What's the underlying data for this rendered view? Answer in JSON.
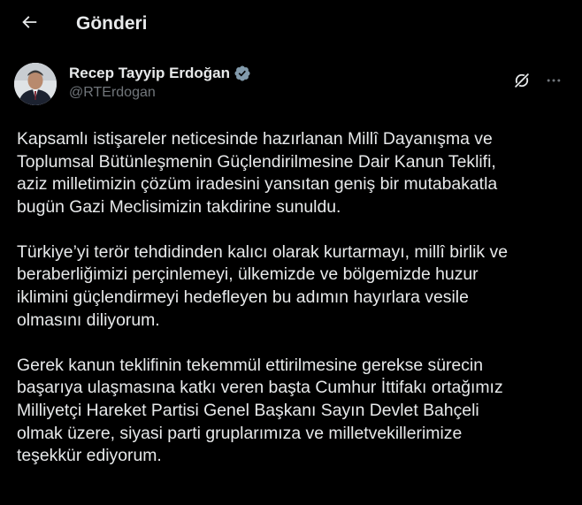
{
  "header": {
    "title": "Gönderi",
    "back_icon": "arrow-left-icon"
  },
  "author": {
    "display_name": "Recep Tayyip Erdoğan",
    "handle": "@RTErdogan",
    "verified_icon": "verified-badge-icon",
    "verified_color": "#829aab"
  },
  "actions": {
    "grok_icon": "grok-icon",
    "more_icon": "more-horizontal-icon"
  },
  "post": {
    "paragraphs": [
      {
        "lines": [
          "Kapsamlı istişareler neticesinde hazırlanan Millî Dayanışma ve",
          "Toplumsal Bütünleşmenin Güçlendirilmesine Dair Kanun Teklifi,",
          "aziz milletimizin çözüm iradesini yansıtan geniş bir mutabakatla",
          "bugün Gazi Meclisimizin takdirine sunuldu."
        ]
      },
      {
        "lines": [
          "Türkiye’yi terör tehdidinden kalıcı olarak kurtarmayı, millî birlik ve",
          "beraberliğimizi perçinlemeyi, ülkemizde ve bölgemizde huzur",
          "iklimini güçlendirmeyi hedefleyen bu adımın hayırlara vesile",
          "olmasını diliyorum."
        ]
      },
      {
        "lines": [
          "Gerek kanun teklifinin tekemmül ettirilmesine gerekse sürecin",
          "başarıya ulaşmasına katkı veren başta Cumhur İttifakı ortağımız",
          "Milliyetçi Hareket Partisi Genel Başkanı Sayın Devlet Bahçeli",
          "olmak üzere, siyasi parti gruplarımıza ve milletvekillerimize",
          "teşekkür ediyorum."
        ]
      }
    ]
  },
  "colors": {
    "background": "#000000",
    "text_primary": "#e7e9ea",
    "text_secondary": "#71767b"
  }
}
